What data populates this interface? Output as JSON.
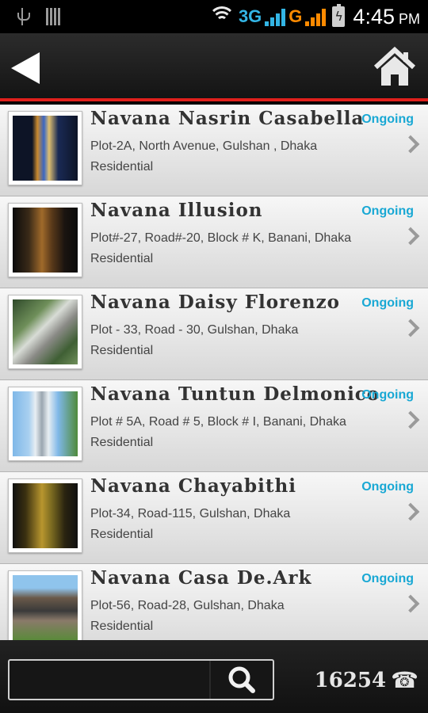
{
  "status_bar": {
    "network_3g": "3G",
    "network_g": "G",
    "time": "4:45",
    "ampm": "PM"
  },
  "header": {
    "back_icon": "back-arrow-icon",
    "home_icon": "home-icon",
    "accent_color": "#e0201c"
  },
  "projects": [
    {
      "name": "Navana Nasrin Casabella",
      "status": "Ongoing",
      "address": "Plot-2A, North Avenue, Gulshan , Dhaka",
      "type": "Residential"
    },
    {
      "name": "Navana Illusion",
      "status": "Ongoing",
      "address": "Plot#-27, Road#-20, Block # K, Banani, Dhaka",
      "type": "Residential"
    },
    {
      "name": "Navana Daisy Florenzo",
      "status": "Ongoing",
      "address": "Plot - 33, Road - 30, Gulshan, Dhaka",
      "type": "Residential"
    },
    {
      "name": "Navana Tuntun Delmonico",
      "status": "Ongoing",
      "address": "Plot # 5A, Road # 5, Block # I, Banani, Dhaka",
      "type": "Residential"
    },
    {
      "name": "Navana Chayabithi",
      "status": "Ongoing",
      "address": "Plot-34, Road-115, Gulshan, Dhaka",
      "type": "Residential"
    },
    {
      "name": "Navana Casa De.Ark",
      "status": "Ongoing",
      "address": "Plot-56, Road-28, Gulshan, Dhaka",
      "type": "Residential"
    }
  ],
  "bottom_bar": {
    "search_value": "",
    "search_icon": "search-icon",
    "hotline": "16254",
    "phone_icon": "phone-icon"
  },
  "colors": {
    "status_blue": "#19a8d4",
    "header_dark": "#1c1c1c"
  }
}
